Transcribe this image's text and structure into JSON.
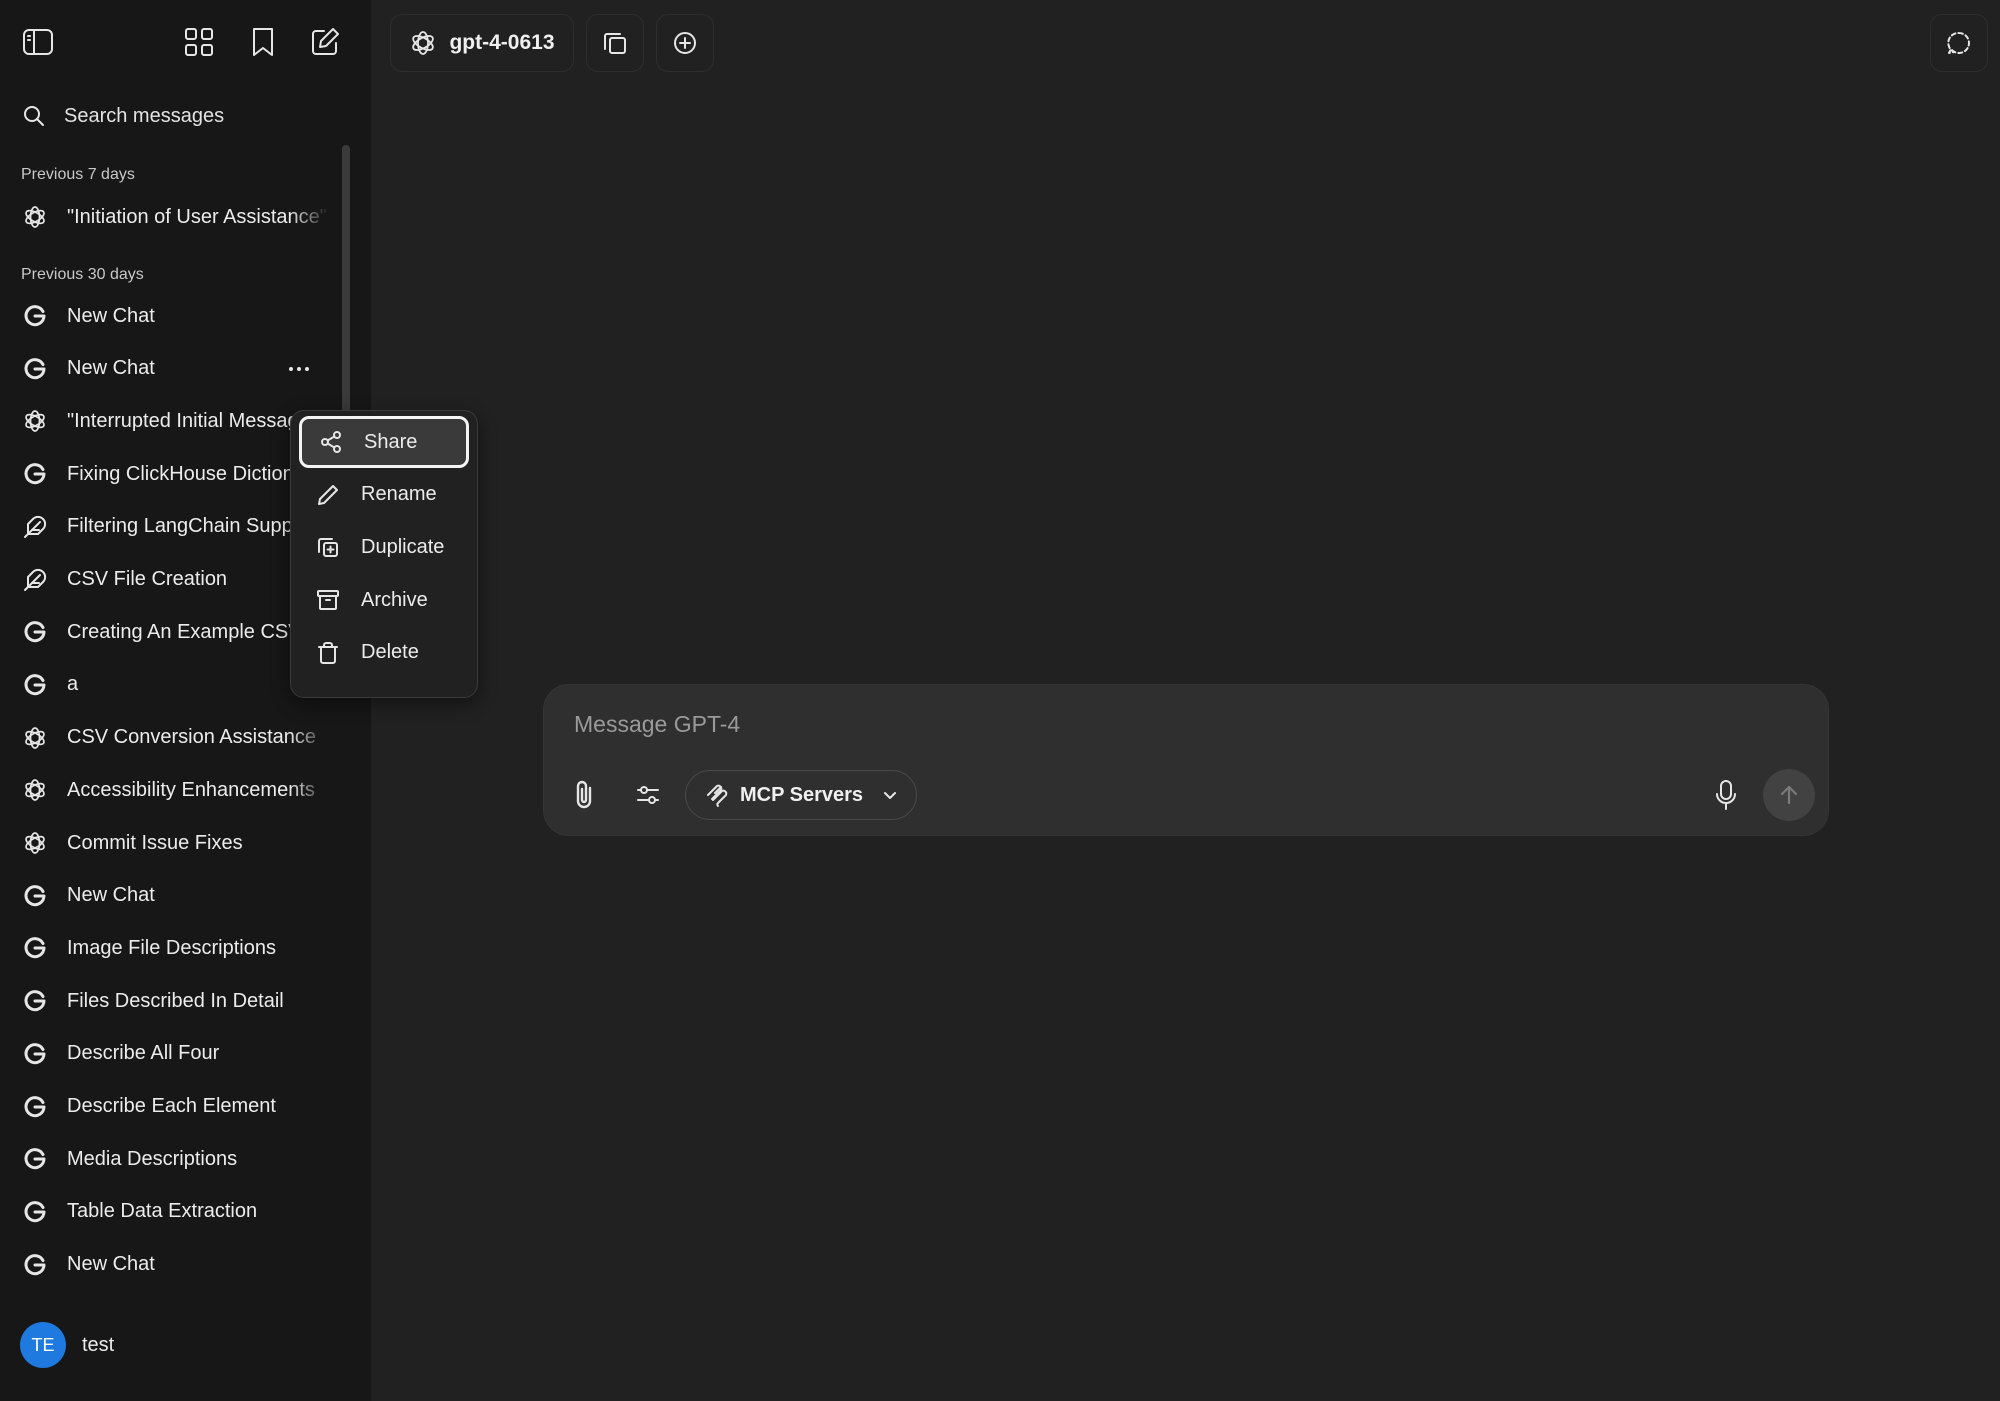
{
  "sidebar": {
    "search_label": "Search messages",
    "sections": [
      {
        "label": "Previous 7 days"
      },
      {
        "label": "Previous 30 days"
      }
    ],
    "recent_items": [
      {
        "title": "\"Initiation of User Assistance\"",
        "icon": "openai-icon"
      }
    ],
    "items": [
      {
        "title": "New Chat",
        "icon": "google-icon"
      },
      {
        "title": "New Chat",
        "icon": "google-icon"
      },
      {
        "title": "\"Interrupted Initial Message\"",
        "icon": "openai-icon"
      },
      {
        "title": "Fixing ClickHouse Dictionary",
        "icon": "google-icon"
      },
      {
        "title": "Filtering LangChain Support",
        "icon": "feather-icon"
      },
      {
        "title": "CSV File Creation",
        "icon": "feather-icon"
      },
      {
        "title": "Creating An Example CSV",
        "icon": "google-icon"
      },
      {
        "title": "a",
        "icon": "google-icon"
      },
      {
        "title": "CSV Conversion Assistance",
        "icon": "openai-icon"
      },
      {
        "title": "Accessibility Enhancements",
        "icon": "openai-icon"
      },
      {
        "title": "Commit Issue Fixes",
        "icon": "openai-icon"
      },
      {
        "title": "New Chat",
        "icon": "google-icon"
      },
      {
        "title": "Image File Descriptions",
        "icon": "google-icon"
      },
      {
        "title": "Files Described In Detail",
        "icon": "google-icon"
      },
      {
        "title": "Describe All Four",
        "icon": "google-icon"
      },
      {
        "title": "Describe Each Element",
        "icon": "google-icon"
      },
      {
        "title": "Media Descriptions",
        "icon": "google-icon"
      },
      {
        "title": "Table Data Extraction",
        "icon": "google-icon"
      },
      {
        "title": "New Chat",
        "icon": "google-icon"
      }
    ],
    "user": {
      "initials": "TE",
      "name": "test"
    }
  },
  "context_menu": {
    "items": [
      {
        "label": "Share",
        "icon": "share-icon",
        "highlighted": true
      },
      {
        "label": "Rename",
        "icon": "pencil-icon"
      },
      {
        "label": "Duplicate",
        "icon": "duplicate-icon"
      },
      {
        "label": "Archive",
        "icon": "archive-icon"
      },
      {
        "label": "Delete",
        "icon": "trash-icon"
      }
    ]
  },
  "header": {
    "model": "gpt-4-0613"
  },
  "composer": {
    "placeholder": "Message GPT-4",
    "mcp_label": "MCP Servers"
  },
  "colors": {
    "background": "#212121",
    "sidebar": "#171717",
    "avatar": "#1f7ae0"
  }
}
